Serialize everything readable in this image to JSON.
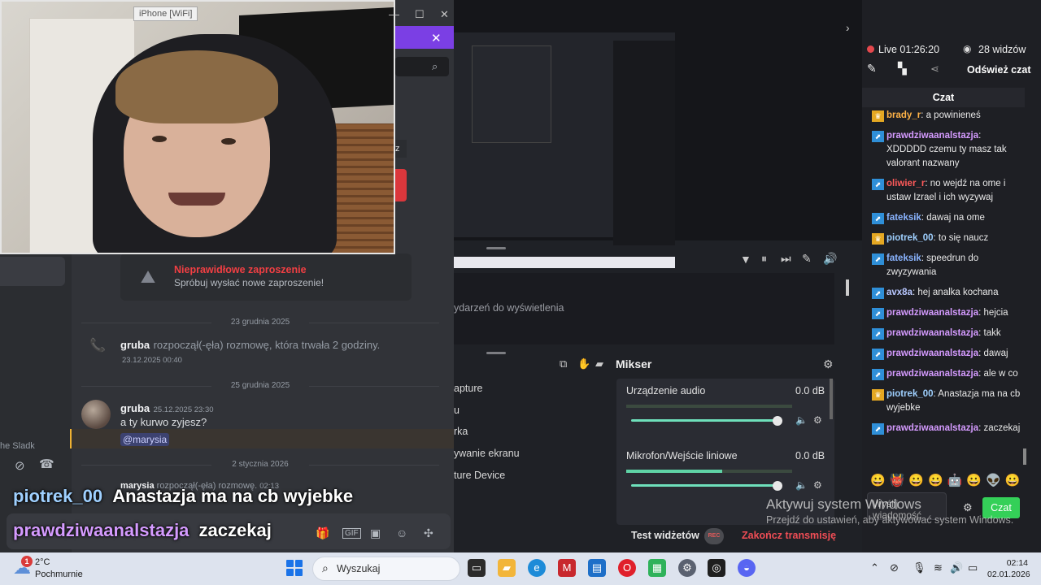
{
  "camera": {
    "device_label": "iPhone [WiFi]"
  },
  "discord": {
    "invite_error": {
      "title": "Nieprawidłowe zaproszenie",
      "subtitle": "Spróbuj wysłać nowe zaproszenie!"
    },
    "date1": "23 grudnia 2025",
    "call1": {
      "user": "gruba",
      "text": "rozpoczął(-ęła) rozmowę, która trwała 2 godziny.",
      "time": "23.12.2025 00:40"
    },
    "date2": "25 grudnia 2025",
    "msg1": {
      "user": "gruba",
      "time": "25.12.2025 23:30",
      "text": "a ty kurwo zyjesz?",
      "mention": "@marysia"
    },
    "date3": "2 stycznia 2026",
    "call2": {
      "user": "marysia",
      "text": "rozpoczął(-ęła) rozmowę.",
      "time": "02:13"
    },
    "partial_left": "he Sladk"
  },
  "overlay": [
    {
      "user": "piotrek_00",
      "text": "Anastazja ma na cb wyjebke",
      "color": "#9fd0ff"
    },
    {
      "user": "prawdziwaanalstazja",
      "text": "zaczekaj",
      "color": "#d59bff"
    }
  ],
  "obs": {
    "events_text": "ydarzeń do wyświetlenia",
    "mixer_title": "Mikser",
    "sources": [
      "apture",
      "u",
      "rka",
      "ywanie ekranu",
      "ture Device"
    ],
    "channels": [
      {
        "name": "Urządzenie audio",
        "db": "0.0 dB",
        "level": 0
      },
      {
        "name": "Mikrofon/Wejście liniowe",
        "db": "0.0 dB",
        "level": 0.58
      }
    ],
    "test_widgets": "Test widżetów",
    "rec_label": "REC",
    "end_stream": "Zakończ transmisję"
  },
  "chat": {
    "live_label": "Live 01:26:20",
    "viewers": "28 widzów",
    "refresh": "Odśwież czat",
    "tab": "Czat",
    "messages": [
      {
        "user": "brady_r",
        "text": ": a powinieneś",
        "color": "#ffb347",
        "badge": "gold"
      },
      {
        "user": "prawdziwaanalstazja",
        "text": ": XDDDDD czemu ty masz tak valorant nazwany",
        "color": "#d59bff",
        "badge": "blue"
      },
      {
        "user": "oliwier_r",
        "text": ": no wejdź na ome i ustaw Izrael i ich wyzywaj",
        "color": "#ff5a5a",
        "badge": "blue"
      },
      {
        "user": "fateksik",
        "text": ": dawaj na ome",
        "color": "#8ab4ff",
        "badge": "blue"
      },
      {
        "user": "piotrek_00",
        "text": ": to się naucz",
        "color": "#9fd0ff",
        "badge": "gold"
      },
      {
        "user": "fateksik",
        "text": ": speedrun do zwyzywania",
        "color": "#8ab4ff",
        "badge": "blue"
      },
      {
        "user": "avx8a",
        "text": ": hej analka kochana",
        "color": "#b8c7ff",
        "badge": "blue"
      },
      {
        "user": "prawdziwaanalstazja",
        "text": ": hejcia",
        "color": "#d59bff",
        "badge": "blue"
      },
      {
        "user": "prawdziwaanalstazja",
        "text": ": takk",
        "color": "#d59bff",
        "badge": "blue"
      },
      {
        "user": "prawdziwaanalstazja",
        "text": ": dawaj",
        "color": "#d59bff",
        "badge": "blue"
      },
      {
        "user": "prawdziwaanalstazja",
        "text": ": ale w co",
        "color": "#d59bff",
        "badge": "blue"
      },
      {
        "user": "piotrek_00",
        "text": ": Anastazja ma na cb wyjebke",
        "color": "#9fd0ff",
        "badge": "gold"
      },
      {
        "user": "prawdziwaanalstazja",
        "text": ": zaczekaj",
        "color": "#d59bff",
        "badge": "blue"
      }
    ],
    "emotes": "😀👹😀😀🤖😀👽😀",
    "input_placeholder": "Wyślij wiadomość",
    "send": "Czat"
  },
  "watermark": {
    "line1": "Aktywuj system Windows",
    "line2": "Przejdź do ustawień, aby aktywować system Windows."
  },
  "taskbar": {
    "temp": "2°C",
    "condition": "Pochmurnie",
    "weather_badge": "1",
    "search_placeholder": "Wyszukaj",
    "time": "02:14",
    "date": "02.01.2026"
  }
}
